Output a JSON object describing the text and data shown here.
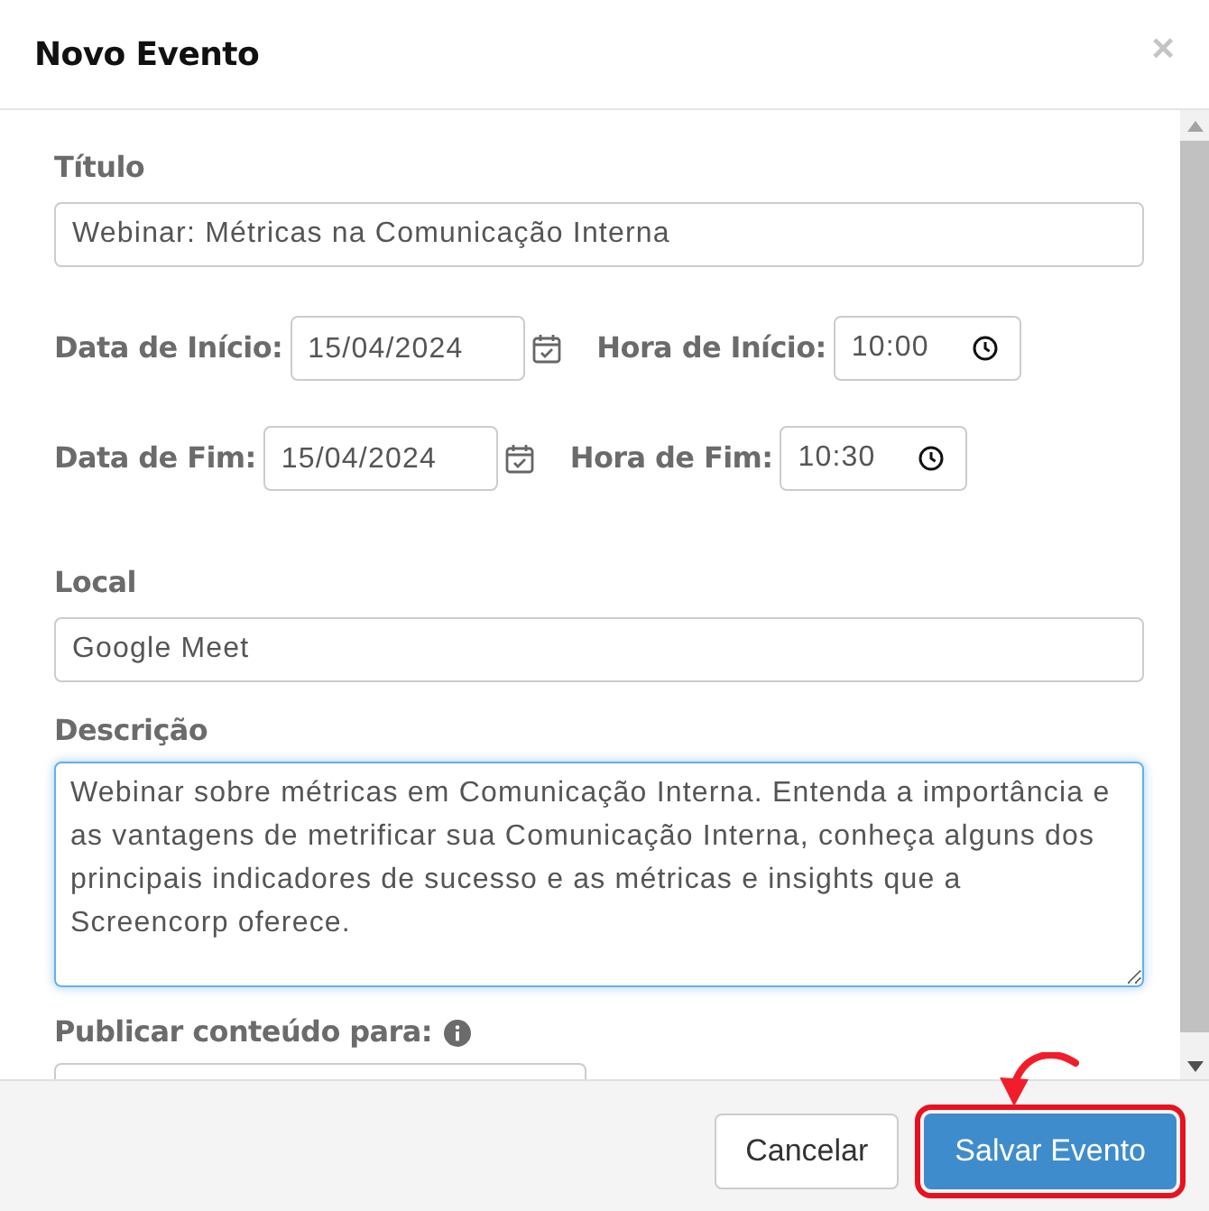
{
  "modal": {
    "title": "Novo Evento",
    "close": "×"
  },
  "title_field": {
    "label": "Título",
    "value": "Webinar: Métricas na Comunicação Interna"
  },
  "schedule_rows": [
    {
      "date_label": "Data de Início:",
      "date": "15/04/2024",
      "time_label": "Hora de Início:",
      "time": "10:00"
    },
    {
      "date_label": "Data de Fim:",
      "date": "15/04/2024",
      "time_label": "Hora de Fim:",
      "time": "10:30"
    }
  ],
  "location_field": {
    "label": "Local",
    "value": "Google Meet"
  },
  "description_field": {
    "label": "Descrição",
    "value": "Webinar sobre métricas em Comunicação Interna. Entenda a importância e as vantagens de metrificar sua Comunicação Interna, conheça alguns dos principais indicadores de sucesso e as métricas e insights que a Screencorp oferece.",
    "focused": true
  },
  "publish_field": {
    "label": "Publicar conteúdo para:"
  },
  "buttons": [
    {
      "label": "Cancelar",
      "kind": "default",
      "highlighted": false
    },
    {
      "label": "Salvar Evento",
      "kind": "primary",
      "highlighted": true
    }
  ]
}
